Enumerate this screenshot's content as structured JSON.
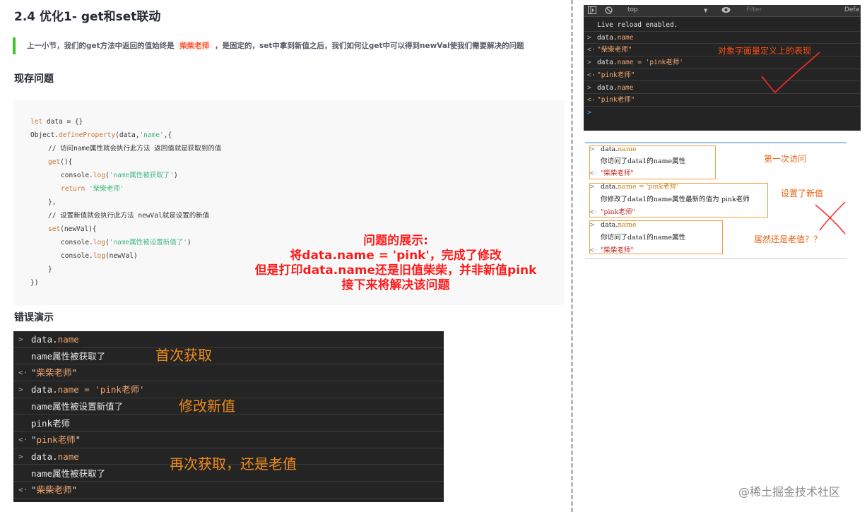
{
  "article": {
    "title": "2.4 优化1- get和set联动",
    "intro_before": "上一小节，我们的get方法中返回的值始终是 ",
    "intro_highlight": "柴柴老师",
    "intro_after": " ，是固定的，set中拿到新值之后，我们如何让get中可以得到newVal使我们需要解决的问题",
    "section_problem": "现存问题",
    "section_demo": "错误演示"
  },
  "code": {
    "l1a": "let",
    "l1b": " data = {}",
    "l2a": "Object.",
    "l2b": "defineProperty",
    "l2c": "(data,",
    "l2d": "'name'",
    "l2e": ",{",
    "l3": "// 访问name属性就会执行此方法 返回值就是获取到的值",
    "l4a": "get",
    "l4b": "(){",
    "l5a": "console.",
    "l5b": "log",
    "l5c": "(",
    "l5d": "'name属性被获取了'",
    "l5e": ")",
    "l6a": "return",
    "l6b": " '柴柴老师'",
    "l7": "},",
    "l8": "// 设置新值就会执行此方法 newVal就是设置的新值",
    "l9a": "set",
    "l9b": "(newVal){",
    "l10a": "console.",
    "l10b": "log",
    "l10c": "(",
    "l10d": "'name属性被设置新值了'",
    "l10e": ")",
    "l11a": "console.",
    "l11b": "log",
    "l11c": "(newVal)",
    "l12": "}",
    "l13": "})"
  },
  "overlay": {
    "line1": "问题的展示:",
    "line2": "将data.name = 'pink'，完成了修改",
    "line3": "但是打印data.name还是旧值柴柴，并非新值pink",
    "line4": "接下来将解决该问题"
  },
  "console_main": {
    "rows": [
      {
        "prefix": ">",
        "a": "data.",
        "b": "name",
        "c": ""
      },
      {
        "prefix": "",
        "a": "name属性被获取了",
        "b": "",
        "c": ""
      },
      {
        "prefix": "<·",
        "a": "\"",
        "b": "柴柴老师",
        "c": "\""
      },
      {
        "prefix": ">",
        "a": "data.",
        "b": "name",
        "c": " = 'pink老师'"
      },
      {
        "prefix": "",
        "a": "name属性被设置新值了",
        "b": "",
        "c": ""
      },
      {
        "prefix": "",
        "a": "pink老师",
        "b": "",
        "c": ""
      },
      {
        "prefix": "<·",
        "a": "\"",
        "b": "pink老师",
        "c": "\""
      },
      {
        "prefix": ">",
        "a": "data.",
        "b": "name",
        "c": ""
      },
      {
        "prefix": "",
        "a": "name属性被获取了",
        "b": "",
        "c": ""
      },
      {
        "prefix": "<·",
        "a": "\"",
        "b": "柴柴老师",
        "c": "\""
      }
    ],
    "annotations": {
      "first_get": "首次获取",
      "set_new": "修改新值",
      "get_again": "再次获取，还是老值"
    }
  },
  "devtools_top": {
    "toolbar": {
      "context": "top",
      "filter_placeholder": "Filter",
      "levels": "Defa"
    },
    "rows": [
      {
        "prefix": "",
        "text": "Live reload enabled."
      },
      {
        "prefix": ">",
        "text": "data.name"
      },
      {
        "prefix": "<·",
        "text": "\"柴柴老师\""
      },
      {
        "prefix": ">",
        "text": "data.name = 'pink老师'"
      },
      {
        "prefix": "<·",
        "text": "\"pink老师\""
      },
      {
        "prefix": ">",
        "text": "data.name"
      },
      {
        "prefix": "<·",
        "text": "\"pink老师\""
      },
      {
        "prefix": ">",
        "text": ""
      }
    ],
    "annotation": "对象字面量定义上的表现"
  },
  "devtools_second": {
    "rows": [
      {
        "prefix": ">",
        "text": "data.name"
      },
      {
        "prefix": "",
        "text": "你访问了data1的name属性"
      },
      {
        "prefix": "<·",
        "text": "\"柴柴老师\""
      },
      {
        "prefix": ">",
        "text": "data.name = 'pink老师'"
      },
      {
        "prefix": "",
        "text": "你修改了data1的name属性最新的值为 pink老师"
      },
      {
        "prefix": "<·",
        "text": "\"pink老师\""
      },
      {
        "prefix": ">",
        "text": "data.name"
      },
      {
        "prefix": "",
        "text": "你访问了data1的name属性"
      },
      {
        "prefix": "<·",
        "text": "\"柴柴老师\""
      }
    ],
    "annotations": {
      "first": "第一次访问",
      "set": "设置了新值",
      "still": "居然还是老值？？"
    }
  },
  "watermark": "@稀土掘金技术社区",
  "colors": {
    "accent_green": "#42c02e",
    "highlight_red": "#ff502c",
    "annotation_orange": "#f08c1c",
    "overlay_red": "#ff1a1a"
  },
  "icons": [
    "panel-toggle-icon",
    "block-icon",
    "eye-icon",
    "dropdown-caret-icon"
  ]
}
